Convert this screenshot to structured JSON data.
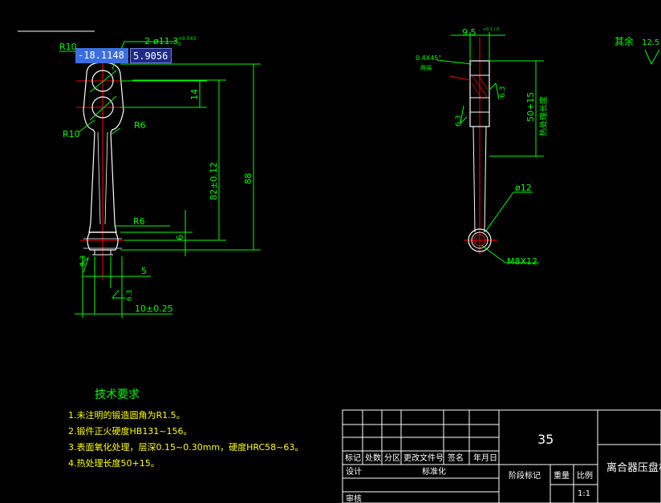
{
  "coordinate_input": {
    "x_value": "-18.1148",
    "y_value": "5.9056"
  },
  "dimensions": {
    "r10_top": "R10",
    "hole_spec": "2-ø11.3",
    "hole_tol_upper": "+0.043",
    "hole_tol_lower": "0",
    "r10_left": "R10",
    "r6_upper": "R6",
    "r6_lower": "R6",
    "dim_14": "14",
    "dim_82": "82±0.12",
    "dim_88": "88",
    "dim_6": "6",
    "dim_5": "5",
    "dim_10": "10±0.25",
    "rough_63_left": "6.3",
    "rough_63_bottom": "6.3",
    "dim_95": "9.5",
    "dim_95_tol": "+0.1 / 0",
    "chamfer": "0.4X45°",
    "chamfer_note": "两端",
    "rough_63_side_a": "6.3",
    "rough_63_side_b": "6.3",
    "dim_50": "50+15",
    "heat_len": "热处理长度",
    "dia_12": "ø12",
    "thread": "M8X12",
    "other_label": "其余",
    "other_rough": "12.5"
  },
  "tech_requirements": {
    "title": "技术要求",
    "items": [
      "1.未注明的锻造圆角为R1.5。",
      "2.锻件正火硬度HB131~156。",
      "3.表面氧化处理，层深0.15~0.30mm，硬度HRC58~63。",
      "4.热处理长度50+15。"
    ]
  },
  "title_block": {
    "material": "35",
    "part_name": "离合器压盘杠",
    "headers": [
      "标记",
      "处数",
      "分区",
      "更改文件号",
      "签名",
      "年月日"
    ],
    "design": "设计",
    "standardize": "标准化",
    "review": "审核",
    "stage_mark": "阶段标记",
    "weight": "重量",
    "scale_label": "比例",
    "scale_value": "1:1"
  },
  "colors": {
    "outline": "#ffffff",
    "dimension": "#00ff00",
    "center": "#ff0000",
    "hatch": "#ff0000",
    "note_yellow": "#ffff00",
    "border": "#ffffff"
  }
}
